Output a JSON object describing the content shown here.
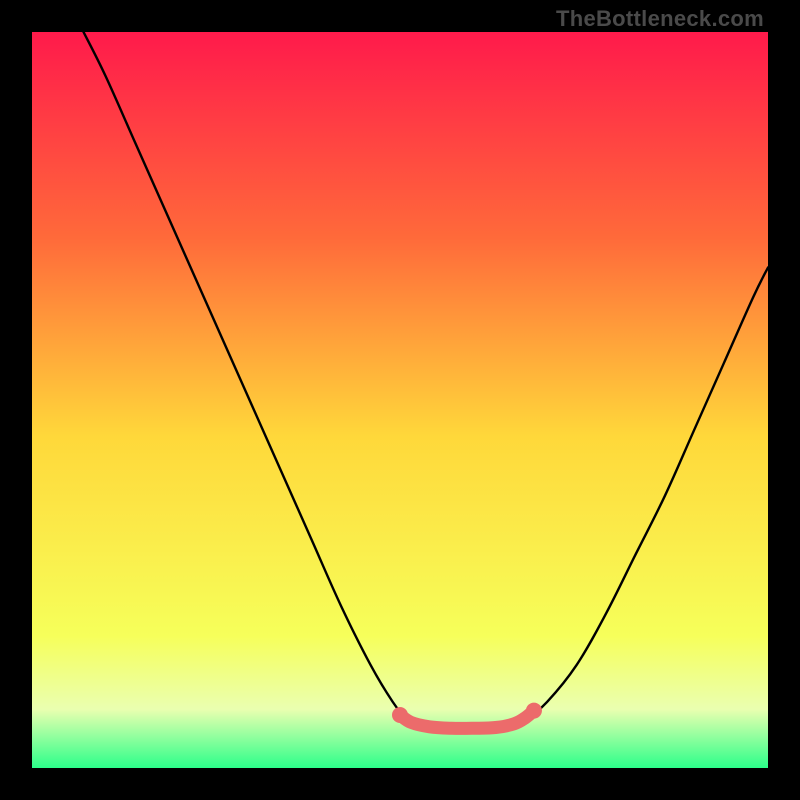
{
  "watermark": "TheBottleneck.com",
  "chart_data": {
    "type": "line",
    "title": "",
    "xlabel": "",
    "ylabel": "",
    "xlim": [
      0,
      100
    ],
    "ylim": [
      0,
      100
    ],
    "background_gradient": {
      "top": "#ff1a4b",
      "mid_upper": "#ff6a3a",
      "mid": "#ffd83a",
      "mid_lower": "#f6ff5a",
      "bottom": "#2cff8a"
    },
    "series": [
      {
        "name": "left-curve",
        "stroke": "#000000",
        "x": [
          7,
          10,
          14,
          18,
          22,
          26,
          30,
          34,
          38,
          42,
          46,
          49,
          51,
          52.5
        ],
        "y": [
          100,
          94,
          85,
          76,
          67,
          58,
          49,
          40,
          31,
          22,
          14,
          9,
          6.5,
          5.5
        ]
      },
      {
        "name": "right-curve",
        "stroke": "#000000",
        "x": [
          65,
          67,
          70,
          74,
          78,
          82,
          86,
          90,
          94,
          98,
          100
        ],
        "y": [
          5.5,
          6.5,
          9,
          14,
          21,
          29,
          37,
          46,
          55,
          64,
          68
        ]
      },
      {
        "name": "flat-bottom",
        "stroke": "#000000",
        "x": [
          52.5,
          65
        ],
        "y": [
          5.5,
          5.5
        ]
      },
      {
        "name": "bottom-markers",
        "stroke": "#ec6b6b",
        "marker_color": "#ec6b6b",
        "x": [
          50,
          51.5,
          54,
          57,
          60,
          63,
          65.5,
          67,
          68.2
        ],
        "y": [
          7.2,
          6.2,
          5.6,
          5.4,
          5.4,
          5.5,
          6.0,
          6.8,
          7.8
        ]
      }
    ]
  }
}
